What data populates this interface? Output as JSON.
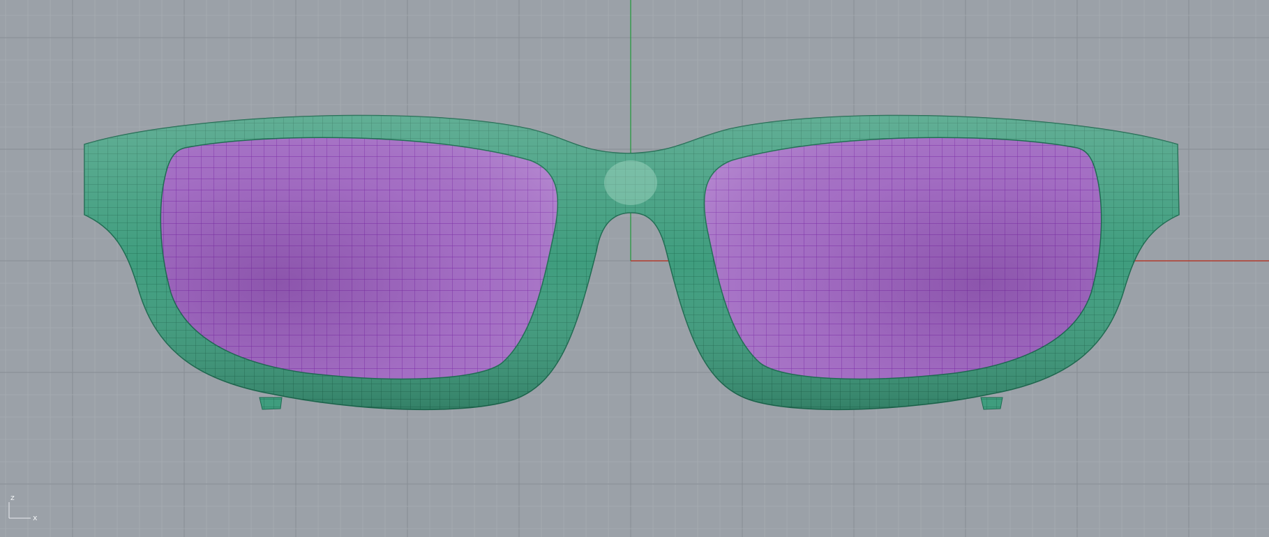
{
  "viewport": {
    "colors": {
      "background": "#9ba1a8",
      "grid_minor": "#a6acb2",
      "grid_major": "#878d94",
      "axis_x": "#b23a2c",
      "axis_z": "#2f9a47",
      "frame_fill": "#3f9d7e",
      "frame_wire": "#1d6b50",
      "lens_fill": "#a772c7",
      "lens_wire": "#7d2da8"
    },
    "axis_widget": {
      "z_label": "z",
      "x_label": "x"
    }
  },
  "scene": {
    "objects": [
      {
        "name": "frame",
        "icon": "eyeglass-frame-mesh"
      },
      {
        "name": "left-lens",
        "icon": "lens-mesh"
      },
      {
        "name": "right-lens",
        "icon": "lens-mesh"
      },
      {
        "name": "left-nose-pad",
        "icon": "nose-pad-mesh"
      },
      {
        "name": "right-nose-pad",
        "icon": "nose-pad-mesh"
      }
    ]
  }
}
